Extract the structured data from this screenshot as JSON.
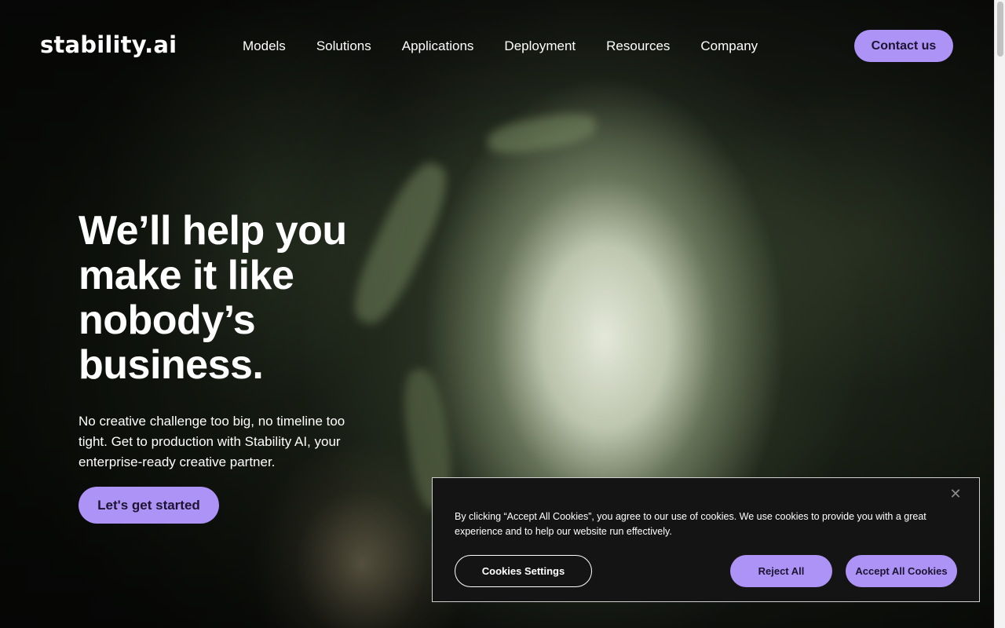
{
  "header": {
    "logo_text": "stability.ai",
    "nav": [
      "Models",
      "Solutions",
      "Applications",
      "Deployment",
      "Resources",
      "Company"
    ],
    "contact_label": "Contact us"
  },
  "hero": {
    "title": "We’ll help you make it like nobody’s business.",
    "subtitle": "No creative challenge too big, no timeline too tight. Get to production with Stability AI, your enterprise-ready creative partner.",
    "cta_label": "Let's get started"
  },
  "cookie_banner": {
    "text": "By clicking “Accept All Cookies”, you agree to our use of cookies. We use cookies to provide you with a great experience and to help our website run effectively.",
    "settings_label": "Cookies Settings",
    "reject_label": "Reject All",
    "accept_label": "Accept All Cookies",
    "close_icon": "close-icon"
  },
  "colors": {
    "accent": "#ae93f7",
    "banner_bg": "#141414"
  }
}
